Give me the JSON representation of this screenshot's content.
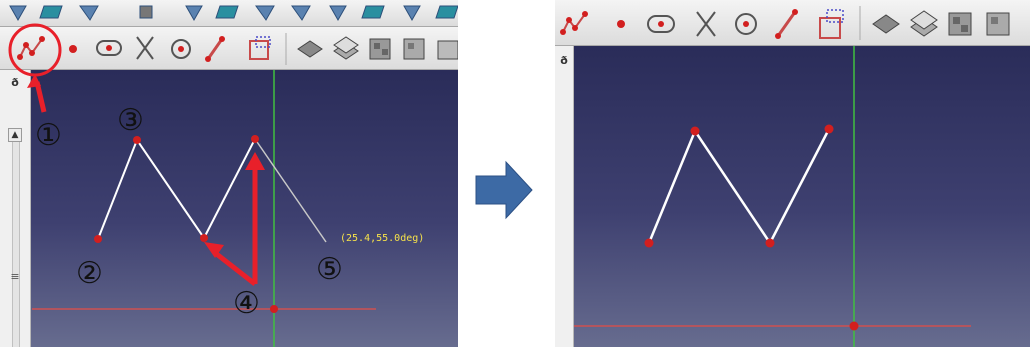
{
  "left": {
    "float_label": "ð",
    "scroll_up": "▲",
    "scroll_mid": "≡",
    "coordinate_readout": "(25.4,55.0deg)",
    "steps": [
      "①",
      "②",
      "③",
      "④",
      "⑤"
    ]
  },
  "right": {
    "float_label": "ð"
  },
  "transition_arrow": "arrow-right-icon",
  "colors": {
    "annotation_red": "#e8202a",
    "point_red": "#d21f1f",
    "axis_green": "#40c040",
    "axis_red": "#d05050",
    "line_white": "#ffffff",
    "preview_gray": "#c8c8c8",
    "arrow_blue": "#3d6aa5",
    "coord_yellow": "#f6e24a"
  },
  "icons": [
    "polyline-icon",
    "point-icon",
    "slot-icon",
    "trim-icon",
    "circle-icon",
    "line-icon",
    "constraint-icon",
    "pad-icon",
    "pocket-icon",
    "fillet-icon",
    "chamfer-icon"
  ]
}
